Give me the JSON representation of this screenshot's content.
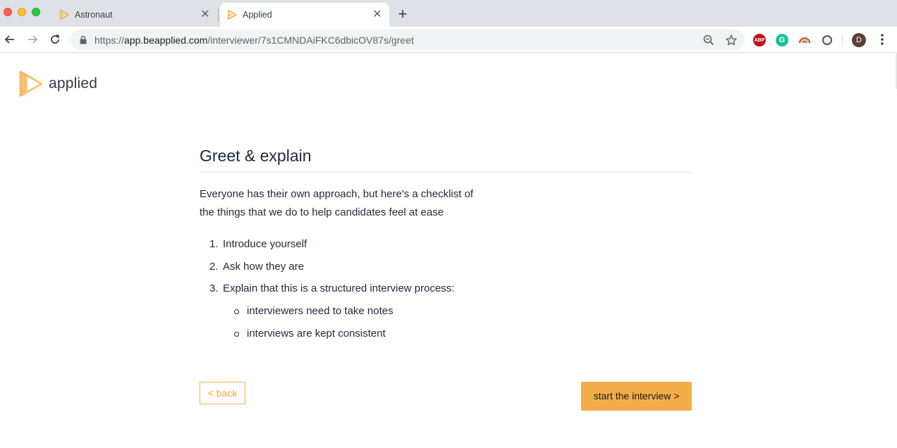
{
  "browser": {
    "tabs": [
      {
        "title": "Astronaut",
        "active": false
      },
      {
        "title": "Applied",
        "active": true
      }
    ],
    "url": {
      "scheme": "https://",
      "host": "app.beapplied.com",
      "path": "/interviewer/7s1CMNDAiFKC6dbicOV87s/greet"
    },
    "extensions": {
      "abp_label": "ABP",
      "grammarly_label": "G"
    },
    "profile_initial": "D"
  },
  "brand": {
    "name": "applied",
    "accent_color": "#f4ad4b"
  },
  "main": {
    "title": "Greet & explain",
    "intro_line_1": "Everyone has their own approach, but here's a checklist of",
    "intro_line_2": "the things that we do to help candidates feel at ease",
    "steps": [
      {
        "number": "1.",
        "text": "Introduce yourself"
      },
      {
        "number": "2.",
        "text": "Ask how they are"
      },
      {
        "number": "3.",
        "text": "Explain that this is a structured interview process:"
      }
    ],
    "sub_points": [
      "interviewers need to take notes",
      "interviews are kept consistent"
    ]
  },
  "actions": {
    "back_label": "< back",
    "start_label": "start the interview >"
  }
}
